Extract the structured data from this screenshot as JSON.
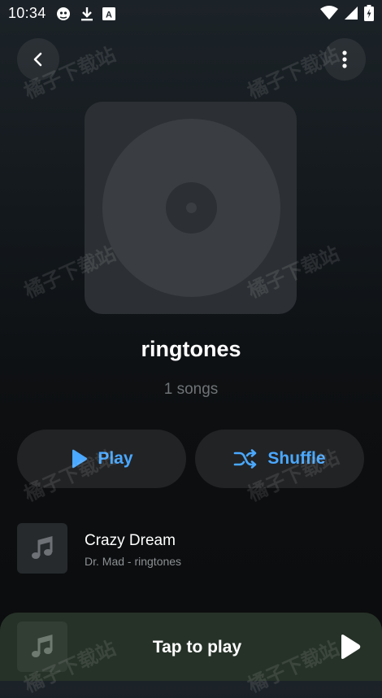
{
  "status_bar": {
    "time": "10:34",
    "icons_left": [
      "bug-icon",
      "download-icon",
      "font-a-icon"
    ],
    "icons_right": [
      "wifi-icon",
      "signal-icon",
      "battery-icon"
    ],
    "font_icon_letter": "A"
  },
  "header": {
    "back_icon": "chevron-left-icon",
    "more_icon": "more-vertical-icon"
  },
  "playlist": {
    "title": "ringtones",
    "count_text": "1 songs"
  },
  "actions": {
    "play_label": "Play",
    "shuffle_label": "Shuffle",
    "accent_color": "#4aa8ff"
  },
  "songs": [
    {
      "title": "Crazy Dream",
      "subtitle": "Dr. Mad - ringtones"
    }
  ],
  "mini_player": {
    "text": "Tap to play"
  },
  "watermark_text": "橘子下载站"
}
